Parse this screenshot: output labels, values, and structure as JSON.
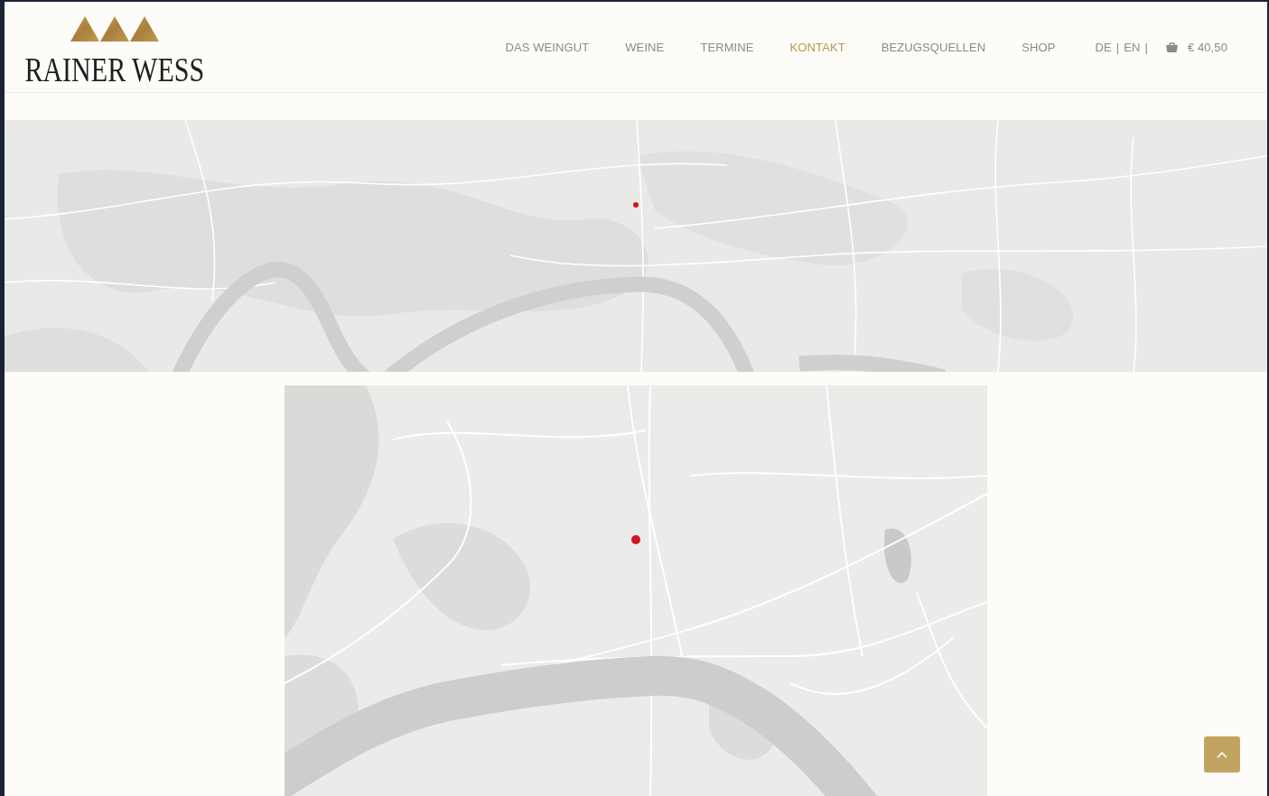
{
  "header": {
    "logo": {
      "text": "RAINER WESS"
    },
    "nav": [
      {
        "label": "DAS WEINGUT",
        "selected": false
      },
      {
        "label": "WEINE",
        "selected": false
      },
      {
        "label": "TERMINE",
        "selected": false
      },
      {
        "label": "KONTAKT",
        "selected": true
      },
      {
        "label": "BEZUGSQUELLEN",
        "selected": false
      },
      {
        "label": "SHOP",
        "selected": false
      }
    ],
    "languages": [
      {
        "label": "DE",
        "separator": "|"
      },
      {
        "label": "EN",
        "separator": "|"
      }
    ],
    "cart": {
      "total": "€ 40,50"
    }
  },
  "maps": [
    {
      "kind": "overview"
    },
    {
      "kind": "detail"
    }
  ]
}
